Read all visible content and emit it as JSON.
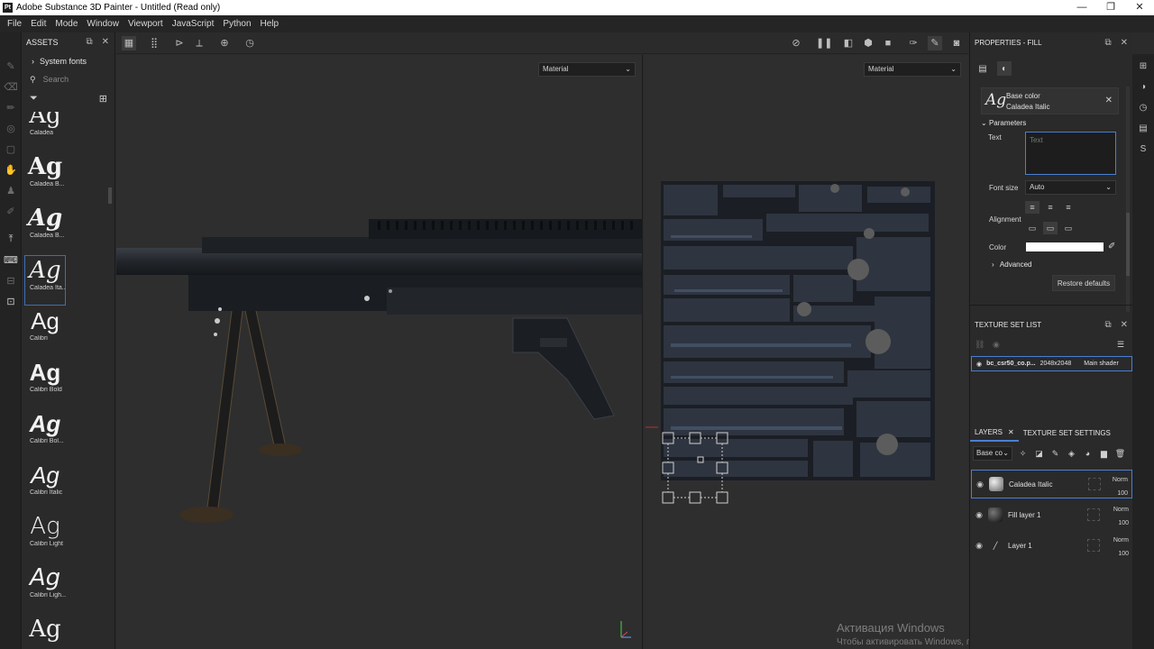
{
  "window": {
    "title": "Adobe Substance 3D Painter - Untitled (Read only)",
    "logo_text": "Pt",
    "controls": [
      "—",
      "❐",
      "✕"
    ]
  },
  "menu": [
    "File",
    "Edit",
    "Mode",
    "Window",
    "Viewport",
    "JavaScript",
    "Python",
    "Help"
  ],
  "assets": {
    "title": "ASSETS",
    "tree_label": "System fonts",
    "search_placeholder": "Search",
    "fonts": [
      {
        "glyph": "Ag",
        "name": "Caladea",
        "style": "normal"
      },
      {
        "glyph": "Ag",
        "name": "Caladea B...",
        "style": "bold"
      },
      {
        "glyph": "Ag",
        "name": "Caladea B...",
        "style": "bolditalic"
      },
      {
        "glyph": "Ag",
        "name": "Caladea Ita...",
        "style": "italic"
      },
      {
        "glyph": "Ag",
        "name": "Calibri",
        "style": "sans"
      },
      {
        "glyph": "Ag",
        "name": "Calibri Bold",
        "style": "sansbold"
      },
      {
        "glyph": "Ag",
        "name": "Calibri Bol...",
        "style": "sansbolditalic"
      },
      {
        "glyph": "Ag",
        "name": "Calibri Italic",
        "style": "sansitalic"
      },
      {
        "glyph": "Ag",
        "name": "Calibri Light",
        "style": "sanslight"
      },
      {
        "glyph": "Ag",
        "name": "Calibri Ligh...",
        "style": "sanslightitalic"
      },
      {
        "glyph": "Ag",
        "name": "",
        "style": "normal"
      }
    ]
  },
  "viewport": {
    "left_mode": "Material",
    "right_mode": "Material"
  },
  "watermark": {
    "line1": "Активация Windows",
    "line2": "Чтобы активировать Windows, перейдите в раздел \"Параметры\"."
  },
  "properties": {
    "title": "PROPERTIES - FILL",
    "base_color_label": "Base color",
    "base_color_font": "Caladea Italic",
    "base_color_glyph": "Ag",
    "parameters_label": "Parameters",
    "text_label": "Text",
    "text_placeholder": "Text",
    "font_size_label": "Font size",
    "font_size_value": "Auto",
    "alignment_label": "Alignment",
    "color_label": "Color",
    "color_value": "#ffffff",
    "advanced_label": "Advanced",
    "restore_label": "Restore defaults"
  },
  "texture_set_list": {
    "title": "TEXTURE SET LIST",
    "row": {
      "name": "bc_csr50_co.p...",
      "size": "2048x2048",
      "shader": "Main shader"
    }
  },
  "layers": {
    "tab_layers": "LAYERS",
    "tab_texture_settings": "TEXTURE SET SETTINGS",
    "channel": "Base co",
    "items": [
      {
        "name": "Caladea Italic",
        "blend": "Norm",
        "opacity": "100",
        "selected": true
      },
      {
        "name": "Fill layer 1",
        "blend": "Norm",
        "opacity": "100",
        "selected": false
      },
      {
        "name": "Layer 1",
        "blend": "Norm",
        "opacity": "100",
        "selected": false
      }
    ]
  },
  "colors": {
    "accent": "#4a7fd1",
    "panel": "#2a2a2a",
    "viewport": "#2e2e2e"
  }
}
